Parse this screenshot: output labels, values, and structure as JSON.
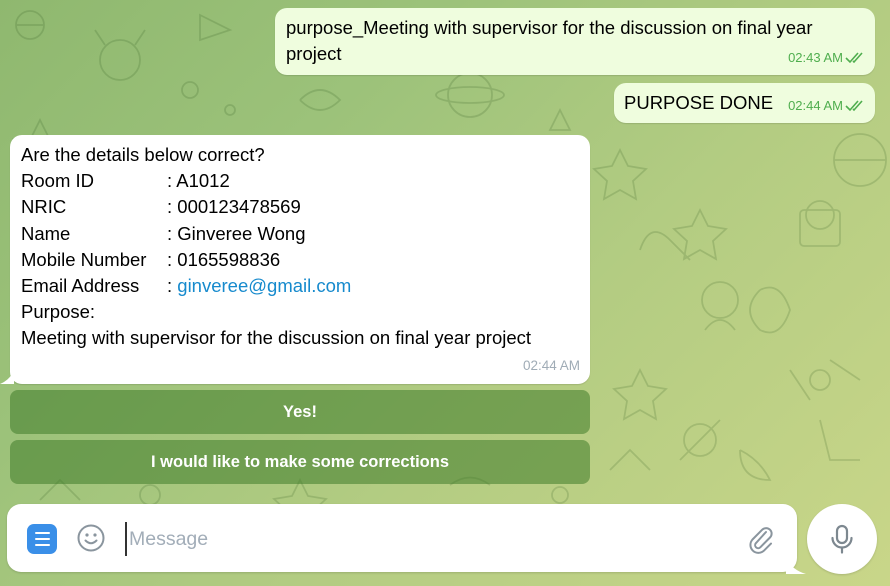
{
  "colors": {
    "outgoing_bubble": "#effdde",
    "incoming_bubble": "#ffffff",
    "read_tick": "#4fae4e",
    "link": "#168acd",
    "keyboard_button": "#407c2a",
    "menu_button": "#3a8fe8"
  },
  "outgoing": [
    {
      "text": "purpose_Meeting with supervisor for the discussion on final year project",
      "time": "02:43 AM",
      "status_icon": "double-check-icon"
    },
    {
      "text": "PURPOSE DONE",
      "time": "02:44 AM",
      "status_icon": "double-check-icon"
    }
  ],
  "incoming": {
    "heading": "Are the details below correct?",
    "fields": [
      {
        "label": "Room ID",
        "value": ": A1012"
      },
      {
        "label": "NRIC",
        "value": ": 000123478569"
      },
      {
        "label": "Name",
        "value": ": Ginveree Wong"
      },
      {
        "label": "Mobile Number",
        "value": ": 0165598836"
      },
      {
        "label": "Email Address",
        "sep": ": ",
        "value": "ginveree@gmail.com"
      }
    ],
    "purpose_label": "Purpose:",
    "purpose_value": "Meeting with supervisor for the discussion on final year project",
    "time": "02:44 AM"
  },
  "keyboard": [
    {
      "label": "Yes!"
    },
    {
      "label": "I would like to make some corrections"
    }
  ],
  "composer": {
    "placeholder": "Message",
    "value": "",
    "icons": [
      "menu-icon",
      "emoji-icon",
      "paperclip-icon",
      "microphone-icon"
    ]
  }
}
